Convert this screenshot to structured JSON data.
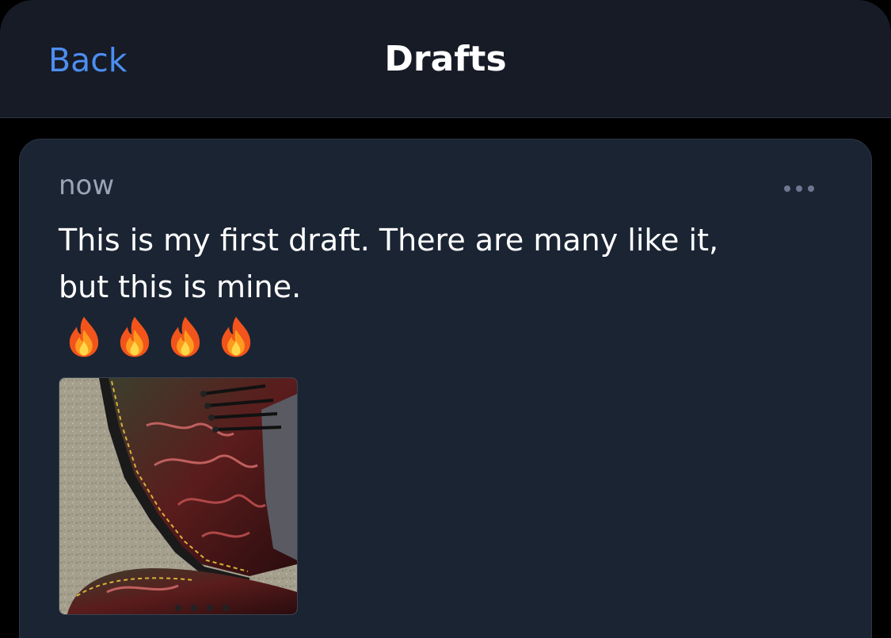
{
  "nav": {
    "back_label": "Back",
    "title": "Drafts"
  },
  "draft": {
    "timestamp": "now",
    "text": "This is my first draft. There are many like it,\nbut this is mine.",
    "emoji": [
      "fire-emoji",
      "fire-emoji",
      "fire-emoji",
      "fire-emoji"
    ],
    "attachment": "boot-photo",
    "more_icon": "ellipsis-icon"
  },
  "colors": {
    "accent": "#4d8ef0",
    "header_bg": "#161b26",
    "card_bg": "#1b2433",
    "muted_text": "#9aa4b5"
  }
}
